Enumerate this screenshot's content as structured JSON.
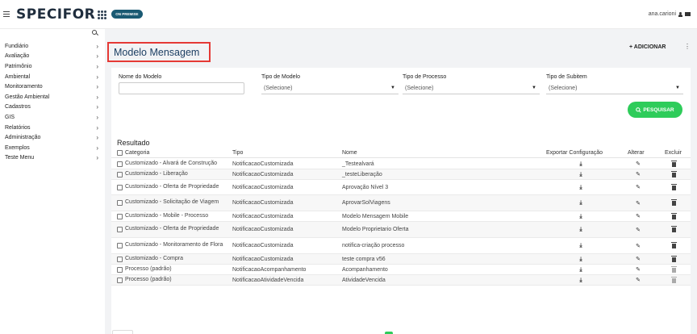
{
  "header": {
    "logo": "SPECIFOR",
    "badge": "ON PREMISE",
    "user": "ana.carioni"
  },
  "sidebar": {
    "items": [
      {
        "label": "Fundiário"
      },
      {
        "label": "Avaliação"
      },
      {
        "label": "Patrimônio"
      },
      {
        "label": "Ambiental"
      },
      {
        "label": "Monitoramento"
      },
      {
        "label": "Gestão Ambiental"
      },
      {
        "label": "Cadastros"
      },
      {
        "label": "GIS"
      },
      {
        "label": "Relatórios"
      },
      {
        "label": "Administração"
      },
      {
        "label": "Exemplos"
      },
      {
        "label": "Teste Menu"
      }
    ]
  },
  "page": {
    "title": "Modelo Mensagem",
    "add_label": "+ ADICIONAR"
  },
  "filters": {
    "nome_label": "Nome do Modelo",
    "tipo_modelo_label": "Tipo de Modelo",
    "tipo_processo_label": "Tipo de Processo",
    "tipo_subitem_label": "Tipo de Subitem",
    "tipo_modelo_value": "(Selecione)",
    "tipo_processo_value": "(Selecione)",
    "tipo_subitem_value": "(Selecione)",
    "search_label": "PESQUISAR"
  },
  "result": {
    "title": "Resultado",
    "columns": {
      "categoria": "Categoria",
      "tipo": "Tipo",
      "nome": "Nome",
      "exportar": "Exportar Configuração",
      "alterar": "Alterar",
      "excluir": "Excluir"
    },
    "rows": [
      {
        "categoria": "Customizado - Alvará de Construção",
        "tipo": "NotificacaoCustomizada",
        "nome": "_Testealvará",
        "deletable": true
      },
      {
        "categoria": "Customizado - Liberação",
        "tipo": "NotificacaoCustomizada",
        "nome": "_testeLiberação",
        "deletable": true
      },
      {
        "categoria": "Customizado - Oferta de Propriedade",
        "tipo": "NotificacaoCustomizada",
        "nome": "Aprovação Nível 3",
        "deletable": true
      },
      {
        "categoria": "Customizado - Solicitação de Viagem",
        "tipo": "NotificacaoCustomizada",
        "nome": "AprovarSolViagens",
        "deletable": true
      },
      {
        "categoria": "Customizado - Mobile - Processo",
        "tipo": "NotificacaoCustomizada",
        "nome": "Modelo Mensagem Mobile",
        "deletable": true
      },
      {
        "categoria": "Customizado - Oferta de Propriedade",
        "tipo": "NotificacaoCustomizada",
        "nome": "Modelo Proprietario Oferta",
        "deletable": true
      },
      {
        "categoria": "Customizado - Monitoramento de Flora",
        "tipo": "NotificacaoCustomizada",
        "nome": "notifica-criação processo",
        "deletable": true
      },
      {
        "categoria": "Customizado - Compra",
        "tipo": "NotificacaoCustomizada",
        "nome": "teste compra v56",
        "deletable": true
      },
      {
        "categoria": "Processo (padrão)",
        "tipo": "NotificacaoAcompanhamento",
        "nome": "Acompanhamento",
        "deletable": false
      },
      {
        "categoria": "Processo (padrão)",
        "tipo": "NotificacaoAtividadeVencida",
        "nome": "AtividadeVencida",
        "deletable": false
      }
    ]
  }
}
